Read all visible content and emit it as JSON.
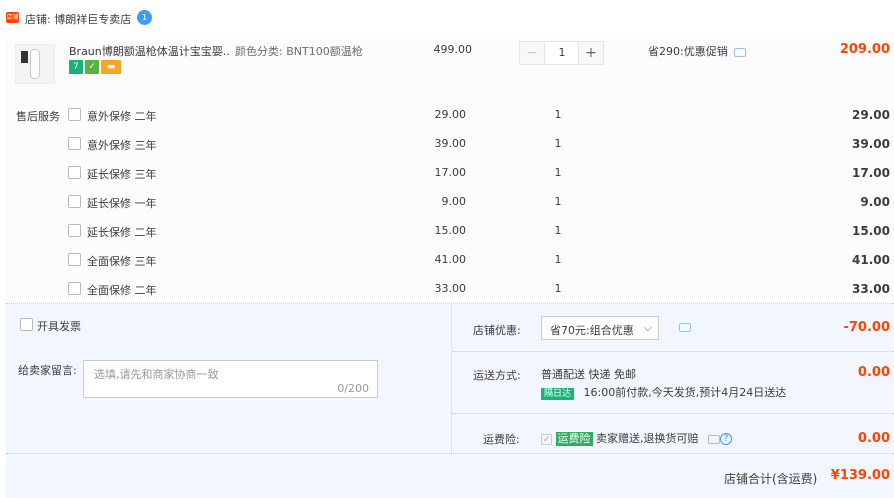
{
  "shop": {
    "badge_text": "店铺",
    "name": "店铺: 博朗祥巨专卖店",
    "badge_icon": "1"
  },
  "item": {
    "title": "Braun博朗额温枪体温计宝宝婴...",
    "sku": "颜色分类: BNT100额温枪",
    "price": "499.00",
    "qty": "1",
    "promo": "省290:优惠促销",
    "total": "209.00",
    "svc_icons": [
      "7",
      "✓",
      "▬"
    ]
  },
  "services": {
    "label": "售后服务",
    "rows": [
      {
        "name": "意外保修 二年",
        "price": "29.00",
        "qty": "1",
        "total": "29.00"
      },
      {
        "name": "意外保修 三年",
        "price": "39.00",
        "qty": "1",
        "total": "39.00"
      },
      {
        "name": "延长保修 三年",
        "price": "17.00",
        "qty": "1",
        "total": "17.00"
      },
      {
        "name": "延长保修 一年",
        "price": "9.00",
        "qty": "1",
        "total": "9.00"
      },
      {
        "name": "延长保修 二年",
        "price": "15.00",
        "qty": "1",
        "total": "15.00"
      },
      {
        "name": "全面保修 三年",
        "price": "41.00",
        "qty": "1",
        "total": "41.00"
      },
      {
        "name": "全面保修 二年",
        "price": "33.00",
        "qty": "1",
        "total": "33.00"
      }
    ]
  },
  "invoice": {
    "label": "开具发票"
  },
  "message": {
    "label": "给卖家留言:",
    "placeholder": "选填,请先和商家协商一致",
    "counter": "0/200"
  },
  "coupon": {
    "label": "店铺优惠:",
    "selected": "省70元:组合优惠",
    "value": "-70.00"
  },
  "shipping": {
    "label": "运送方式:",
    "method": "普通配送 快递 免邮",
    "tag": "隔日达",
    "note": "16:00前付款,今天发货,预计4月24日送达",
    "value": "0.00"
  },
  "insurance": {
    "label": "运费险:",
    "tag": "运费险",
    "note": "卖家赠送,退换货可赔",
    "help": "?",
    "value": "0.00"
  },
  "summary": {
    "label": "店铺合计(含运费)",
    "value": "¥139.00"
  },
  "colors": {
    "accent": "#ff4400",
    "bg_light": "#f2f7ff",
    "green": "#19b37a",
    "blue": "#3c9cf0"
  }
}
